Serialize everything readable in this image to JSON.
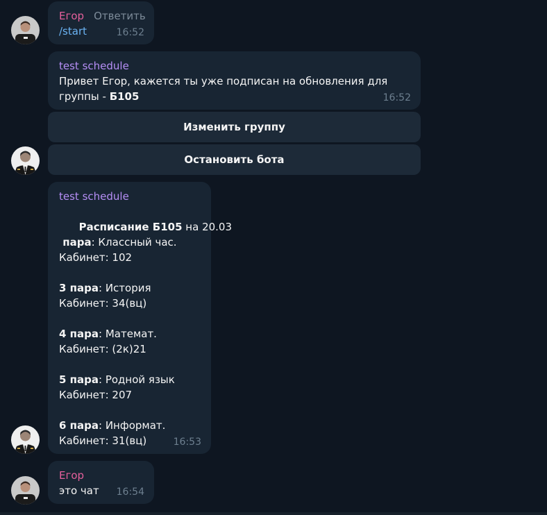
{
  "messages": {
    "m1": {
      "sender": "Егор",
      "reply_action": "Ответить",
      "text": "/start",
      "time": "16:52"
    },
    "m2": {
      "sender": "test schedule",
      "text_line1": "Привет Егор, кажется ты уже подписан на обновления для",
      "text_line2_prefix": "группы - ",
      "text_line2_group": "Б105",
      "time": "16:52",
      "buttons": [
        "Изменить группу",
        "Остановить бота"
      ]
    },
    "m3": {
      "sender": "test schedule",
      "header_bold": "Расписание Б105",
      "header_rest": " на 20.03",
      "lessons": [
        {
          "num": " пара",
          "subject": ": Классный час.",
          "room": "Кабинет: 102"
        },
        {
          "num": "3 пара",
          "subject": ": История",
          "room": "Кабинет: 34(вц)"
        },
        {
          "num": "4 пара",
          "subject": ": Математ.",
          "room": "Кабинет: (2к)21"
        },
        {
          "num": "5 пара",
          "subject": ": Родной язык",
          "room": "Кабинет: 207"
        },
        {
          "num": "6 пара",
          "subject": ": Информат.",
          "room": "Кабинет: 31(вц)"
        }
      ],
      "time": "16:53"
    },
    "m4": {
      "sender": "Егор",
      "text": "это чат",
      "time": "16:54"
    }
  },
  "colors": {
    "background": "#0e1621",
    "bubble": "#182533",
    "user_name": "#e5609c",
    "bot_name": "#b58ef5",
    "link": "#6ab2f2"
  }
}
